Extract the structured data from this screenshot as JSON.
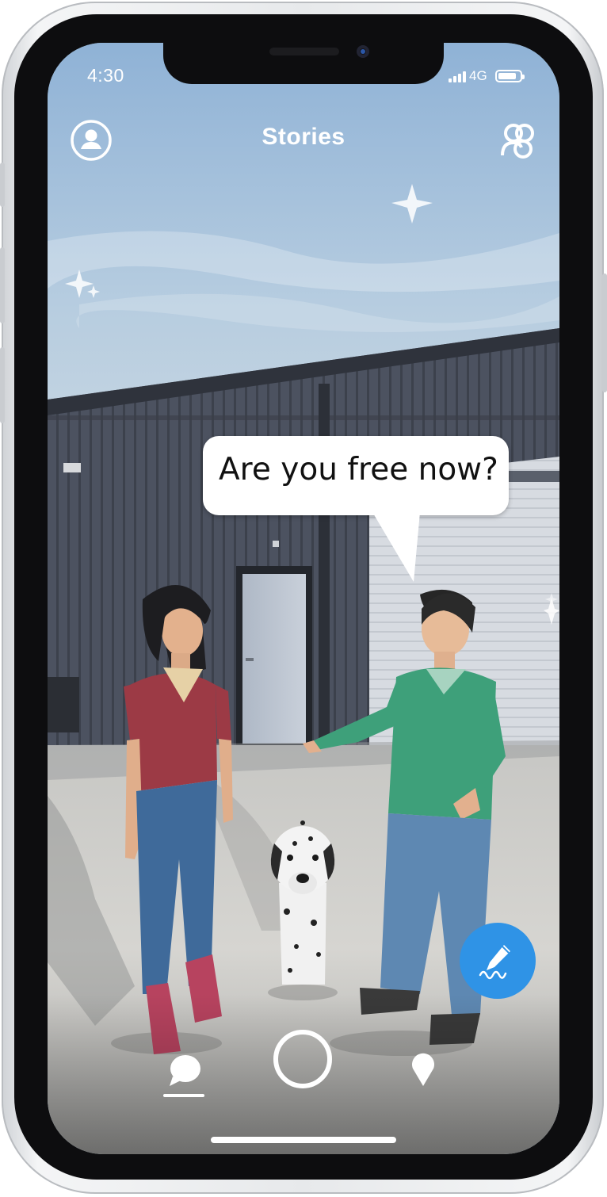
{
  "status_bar": {
    "time": "4:30",
    "network": "4G",
    "battery_fraction": 0.85
  },
  "header": {
    "title": "Stories",
    "profile_icon": "person-circle-icon",
    "friends_icon": "friends-group-icon"
  },
  "speech_bubble": {
    "text": "Are you free now?"
  },
  "fab": {
    "icon": "pen-signature-icon"
  },
  "bottom_nav": {
    "items": [
      "chat-bubble-icon",
      "capture-circle-icon",
      "location-pin-icon"
    ],
    "active": "chat-bubble-icon"
  },
  "colors": {
    "accent": "#2f93e6",
    "sky": "#a9c4dc",
    "building": "#4a4f5a"
  }
}
